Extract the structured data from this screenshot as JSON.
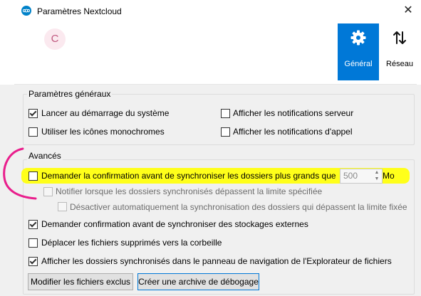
{
  "window": {
    "title": "Paramètres Nextcloud",
    "close_glyph": "✕"
  },
  "account": {
    "avatar_letter": "C"
  },
  "tabs": [
    {
      "label": "Général",
      "icon": "gear-icon",
      "active": true
    },
    {
      "label": "Réseau",
      "icon": "up-down-arrows-icon",
      "active": false
    }
  ],
  "general_group": {
    "title": "Paramètres généraux",
    "options": {
      "launch_startup": {
        "label": "Lancer au démarrage du système",
        "checked": true
      },
      "server_notifications": {
        "label": "Afficher les notifications serveur",
        "checked": false
      },
      "monochrome_icons": {
        "label": "Utiliser les icônes monochromes",
        "checked": false
      },
      "call_notifications": {
        "label": "Afficher les notifications d'appel",
        "checked": false
      }
    }
  },
  "advanced_group": {
    "title": "Avancés",
    "options": {
      "confirm_large_folders": {
        "label": "Demander la confirmation avant de synchroniser les dossiers plus grands que",
        "checked": false
      },
      "size_limit": {
        "value": "500",
        "unit": "Mo"
      },
      "notify_exceed": {
        "label": "Notifier lorsque les dossiers synchronisés dépassent la limite spécifiée",
        "checked": false,
        "disabled": true
      },
      "auto_disable_sync": {
        "label": "Désactiver automatiquement la synchronisation des dossiers qui dépassent la limite fixée",
        "checked": false,
        "disabled": true
      },
      "confirm_external": {
        "label": "Demander confirmation avant de synchroniser des stockages externes",
        "checked": true
      },
      "move_to_trash": {
        "label": "Déplacer les fichiers supprimés vers la corbeille",
        "checked": false
      },
      "show_in_explorer": {
        "label": "Afficher les dossiers synchronisés dans le panneau de navigation de l'Explorateur de fichiers",
        "checked": true
      }
    }
  },
  "buttons": {
    "edit_excluded": "Modifier les fichiers exclus",
    "create_debug_archive": "Créer une archive de débogage"
  },
  "colors": {
    "accent": "#0078d7",
    "highlight": "#ffff1a",
    "annotation": "#e91e8c",
    "avatar_bg": "#fbe9ef",
    "avatar_fg": "#c0587f"
  }
}
